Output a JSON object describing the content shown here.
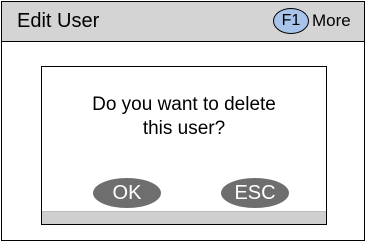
{
  "header": {
    "title": "Edit User",
    "function_key": "F1",
    "more_label": "More"
  },
  "dialog": {
    "message_line1": "Do you want to delete",
    "message_line2": "this user?",
    "ok_label": "OK",
    "esc_label": "ESC"
  },
  "colors": {
    "header_bg": "#d4d4d4",
    "f1_key_bg": "#a8c4ea",
    "button_bg": "#6e6e6e"
  }
}
